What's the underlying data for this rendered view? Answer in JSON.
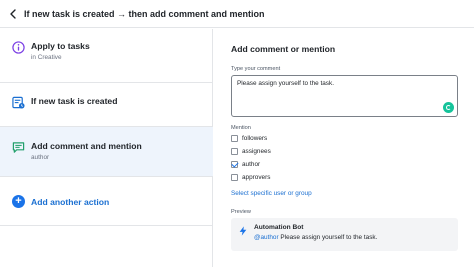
{
  "header": {
    "title": "If new task is created → then add comment and mention"
  },
  "steps": [
    {
      "title": "Apply to tasks",
      "subtitle": "in Creative",
      "icon": "info-circle-icon",
      "color": "#7b3fe4"
    },
    {
      "title": "If new task is created",
      "icon": "task-trigger-icon",
      "color": "#1a6fd1"
    },
    {
      "title": "Add comment and mention",
      "subtitle": "author",
      "icon": "comment-icon",
      "color": "#22a06b"
    }
  ],
  "add_action": {
    "label": "Add another action"
  },
  "panel": {
    "title": "Add comment or mention",
    "comment_label": "Type your comment",
    "comment_value": "Please assign yourself to the task.",
    "mention_label": "Mention",
    "mention_options": [
      {
        "label": "followers",
        "checked": false
      },
      {
        "label": "assignees",
        "checked": false
      },
      {
        "label": "author",
        "checked": true
      },
      {
        "label": "approvers",
        "checked": false
      }
    ],
    "select_link": "Select specific user or group",
    "preview_label": "Preview",
    "preview": {
      "bot_name": "Automation Bot",
      "mention": "@author",
      "message": " Please assign yourself to the task."
    }
  },
  "colors": {
    "accent": "#1a73e8",
    "selected_bg": "#eef4fc"
  }
}
